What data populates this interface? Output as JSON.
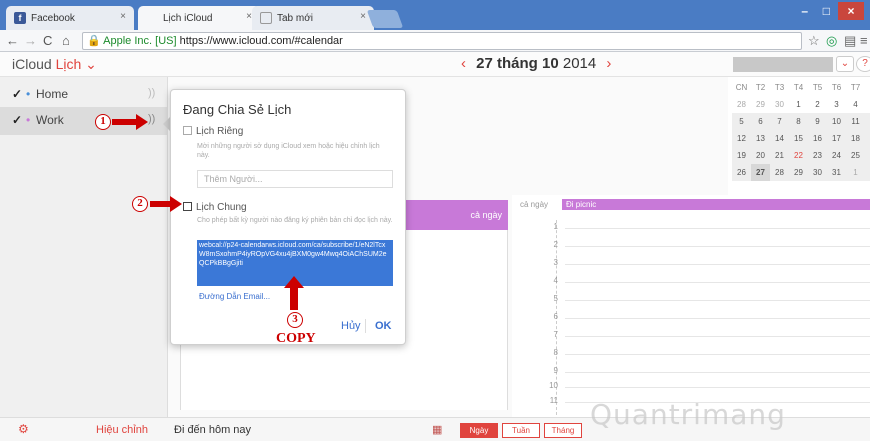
{
  "browser": {
    "tabs": [
      {
        "label": "Facebook",
        "favicon": "facebook-icon"
      },
      {
        "label": "Lịch iCloud",
        "favicon": "apple-icon"
      },
      {
        "label": "Tab mới",
        "favicon": "new-tab-icon"
      }
    ],
    "secure_label": "Apple Inc. [US]",
    "url": "https://www.icloud.com/#calendar"
  },
  "app": {
    "brand": "iCloud",
    "section": "Lịch",
    "date_day": "27 tháng 10",
    "date_year": "2014"
  },
  "sidebar": {
    "items": [
      {
        "label": "Home",
        "checked": "✓",
        "dot_color": "#4a90d9"
      },
      {
        "label": "Work",
        "checked": "✓",
        "dot_color": "#c879d8"
      }
    ]
  },
  "mini_calendar": {
    "headers": [
      "CN",
      "T2",
      "T3",
      "T4",
      "T5",
      "T6",
      "T7"
    ],
    "weeks": [
      [
        "28",
        "29",
        "30",
        "1",
        "2",
        "3",
        "4"
      ],
      [
        "5",
        "6",
        "7",
        "8",
        "9",
        "10",
        "11"
      ],
      [
        "12",
        "13",
        "14",
        "15",
        "16",
        "17",
        "18"
      ],
      [
        "19",
        "20",
        "21",
        "22",
        "23",
        "24",
        "25"
      ],
      [
        "26",
        "27",
        "28",
        "29",
        "30",
        "31",
        "1"
      ]
    ]
  },
  "popup": {
    "title": "Đang Chia Sẻ Lịch",
    "private_label": "Lịch Riêng",
    "private_desc": "Mời những người sở dụng iCloud xem hoặc hiệu chỉnh lịch này.",
    "add_person_placeholder": "Thêm Người...",
    "public_label": "Lịch Chung",
    "public_desc": "Cho phép bất kỳ người nào đăng ký phiên bản chỉ đọc lịch này.",
    "calendar_url": "webcal://p24-calendarws.icloud.com/ca/subscribe/1/eN2lTcxW8mSxohmP4iyROpVG4xu4jBXM0gw4Mwq4OiAChSUM2eQCPkBBgGjiti",
    "email_link": "Đường Dẫn Email...",
    "cancel": "Hủy",
    "ok": "OK"
  },
  "day_view": {
    "all_day_label": "cả ngày",
    "all_day_event": "Đi picnic",
    "hours": [
      "1",
      "2",
      "3",
      "4",
      "5",
      "6",
      "7",
      "8",
      "9",
      "10",
      "11"
    ]
  },
  "annotations": {
    "step1": "1",
    "step2": "2",
    "step3": "3",
    "copy": "COPY"
  },
  "bottom": {
    "edit": "Hiệu chỉnh",
    "goto_today": "Đi đến hôm nay",
    "views": [
      "Ngày",
      "Tuần",
      "Tháng"
    ]
  },
  "watermark": "Quantrimang",
  "colors": {
    "accent": "#e0443e",
    "event": "#c879d8",
    "selection": "#3b78d7",
    "annotation": "#cc0000"
  }
}
